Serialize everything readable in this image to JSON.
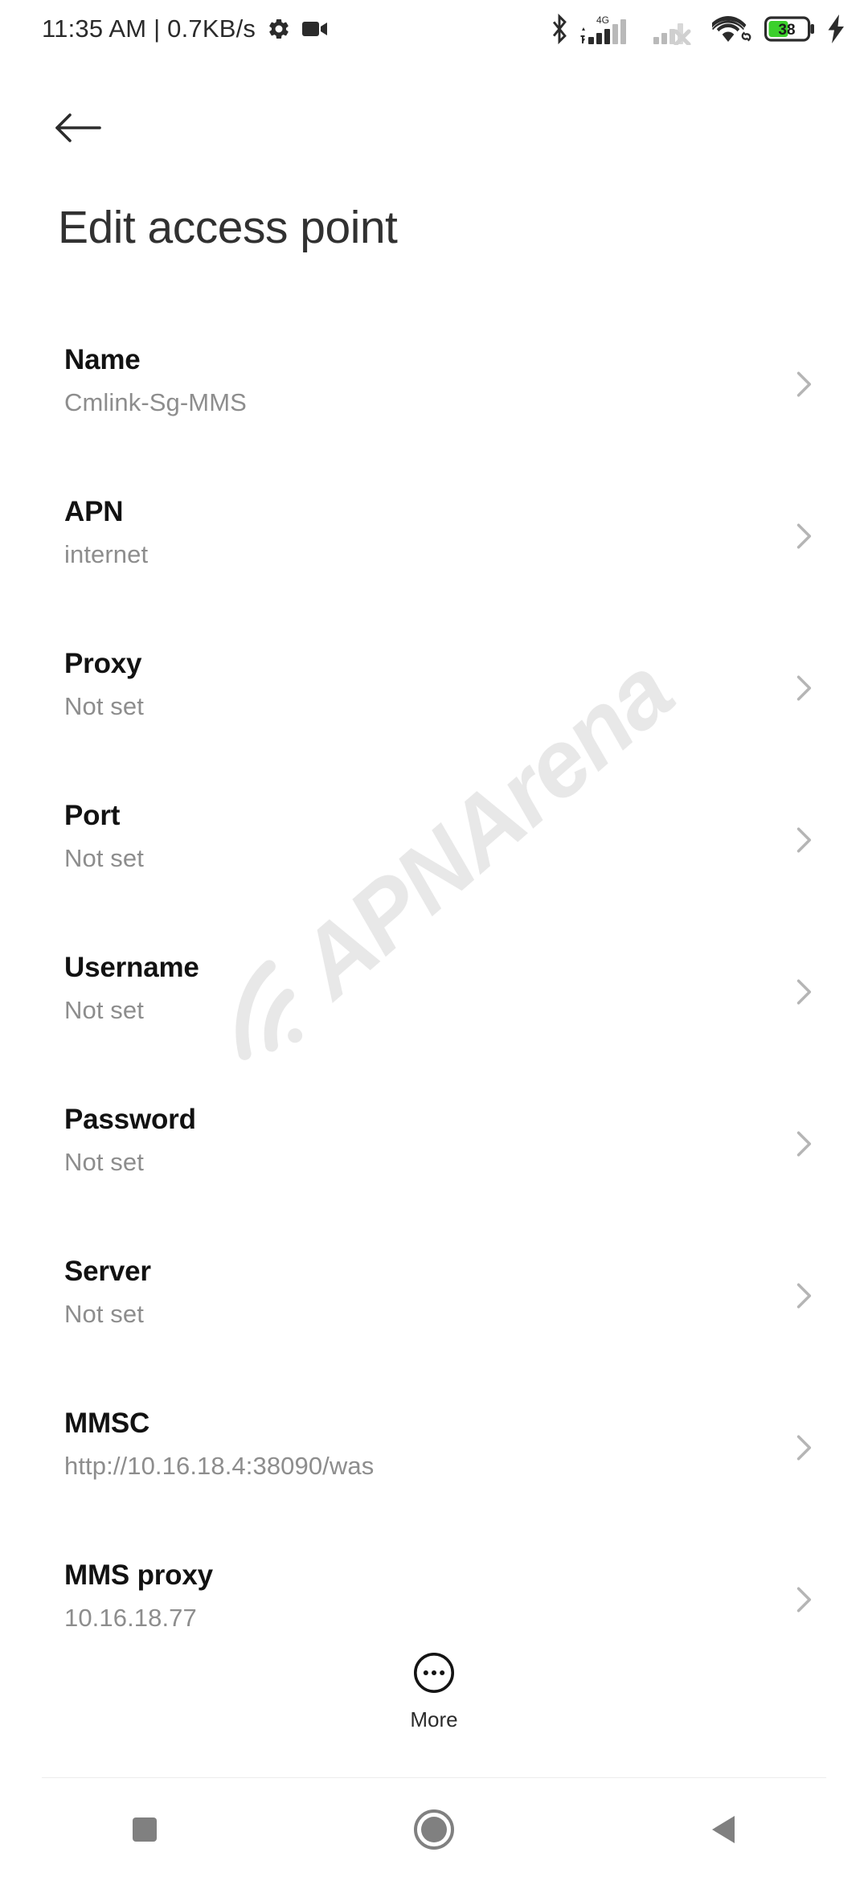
{
  "status_bar": {
    "clock": "11:35 AM | 0.7KB/s",
    "icons": {
      "gear": "gear-icon",
      "video": "video-camera-icon",
      "bluetooth": "bluetooth-icon",
      "network_type": "4G",
      "signal_sim1": "signal-bars-icon",
      "signal_sim2": "signal-bars-no-service-icon",
      "wifi": "wifi-icon",
      "wifi_link": "link-icon",
      "battery": "battery-icon",
      "charging": "charging-bolt-icon"
    },
    "battery_level": "38",
    "battery_color": "#3bd02b"
  },
  "app_bar": {
    "back_icon": "back-arrow-icon",
    "title": "Edit access point"
  },
  "watermark": {
    "text": "APNArena",
    "logo": "wifi-arc-logo",
    "color": "#e8e8e8"
  },
  "settings_list": {
    "chevron_icon": "chevron-right-icon",
    "rows": [
      {
        "title": "Name",
        "value": "Cmlink-Sg-MMS"
      },
      {
        "title": "APN",
        "value": "internet"
      },
      {
        "title": "Proxy",
        "value": "Not set"
      },
      {
        "title": "Port",
        "value": "Not set"
      },
      {
        "title": "Username",
        "value": "Not set"
      },
      {
        "title": "Password",
        "value": "Not set"
      },
      {
        "title": "Server",
        "value": "Not set"
      },
      {
        "title": "MMSC",
        "value": "http://10.16.18.4:38090/was"
      },
      {
        "title": "MMS proxy",
        "value": "10.16.18.77"
      }
    ]
  },
  "more_button": {
    "label": "More",
    "icon": "more-circle-icon"
  },
  "nav_bar": {
    "recents": "recents-square-icon",
    "home": "home-circle-icon",
    "back": "back-triangle-icon",
    "color": "#808080"
  }
}
